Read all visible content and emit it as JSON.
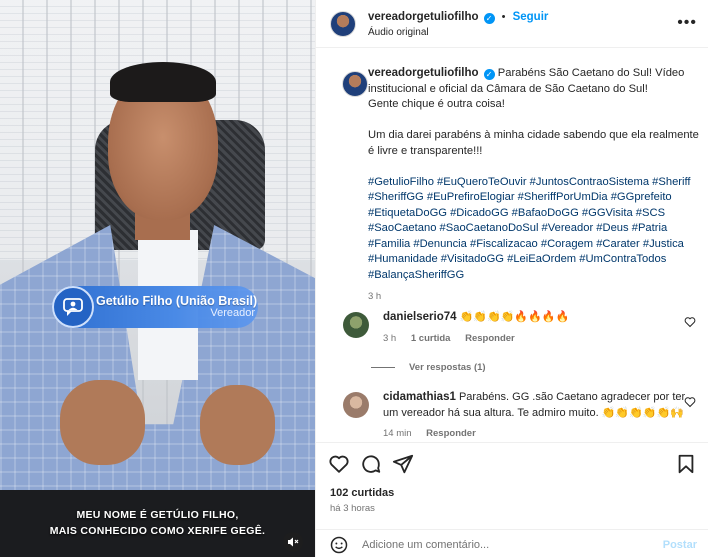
{
  "video": {
    "lower_third_name": "Getúlio Filho (União Brasil)",
    "lower_third_role": "Vereador",
    "subtitle_line1": "MEU NOME É GETÚLIO FILHO,",
    "subtitle_line2": "MAIS CONHECIDO COMO XERIFE GEGÊ.",
    "mute_icon": "speaker-muted-icon"
  },
  "header": {
    "username": "vereadorgetuliofilho",
    "follow_label": "Seguir",
    "audio_label": "Áudio original",
    "more_icon": "more-horizontal-icon"
  },
  "caption": {
    "username": "vereadorgetuliofilho",
    "line1": "Parabéns São Caetano do Sul! Vídeo institucional e oficial da Câmara de São Caetano do Sul!",
    "line2": "Gente chique é outra coisa!",
    "line3": "Um dia darei parabéns à minha cidade sabendo que ela realmente é livre e transparente!!!",
    "hashtags": "#GetulioFilho #EuQueroTeOuvir #JuntosContraoSistema #Sheriff #SheriffGG #EuPrefiroElogiar #SheriffPorUmDia #GGprefeito #EtiquetaDoGG #DicadoGG #BafaoDoGG #GGVisita #SCS #SaoCaetano #SaoCaetanoDoSul #Vereador #Deus #Patria #Familia #Denuncia #Fiscalizacao #Coragem #Carater #Justica #Humanidade #VisitadoGG #LeiEaOrdem #UmContraTodos #BalançaSheriffGG",
    "time": "3 h"
  },
  "comments": [
    {
      "username": "danielserio74",
      "text": "👏👏👏👏🔥🔥🔥🔥",
      "time": "3 h",
      "likes": "1 curtida",
      "reply": "Responder",
      "see_replies": "Ver respostas (1)"
    },
    {
      "username": "cidamathias1",
      "text": "Parabéns. GG .são Caetano agradecer por ter um vereador há sua altura. Te admiro muito. 👏👏👏👏👏🙌",
      "time": "14 min",
      "reply": "Responder"
    }
  ],
  "actions": {
    "likes": "102 curtidas",
    "ago": "há 3 horas"
  },
  "add_comment": {
    "placeholder": "Adicione um comentário...",
    "post_label": "Postar"
  },
  "colors": {
    "accent": "#0095f6",
    "hashtag": "#00376b",
    "muted_text": "#737373"
  }
}
